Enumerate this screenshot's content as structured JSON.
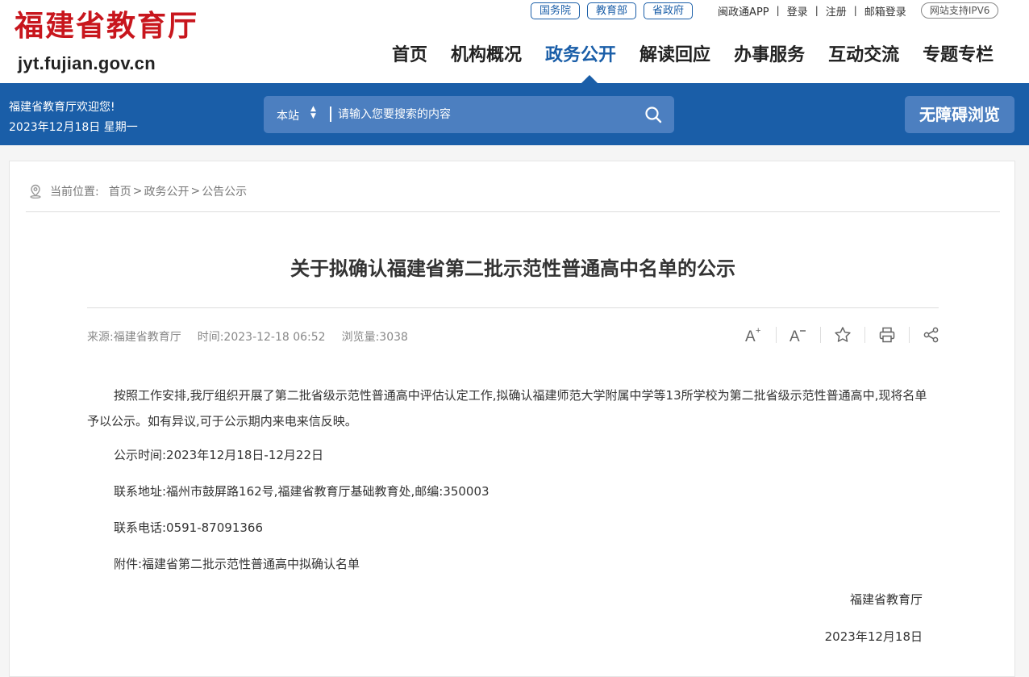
{
  "header": {
    "logo_cn": "福建省教育厅",
    "logo_url": "jyt.fujian.gov.cn",
    "pills": [
      "国务院",
      "教育部",
      "省政府"
    ],
    "links": [
      "闽政通APP",
      "登录",
      "注册",
      "邮箱登录"
    ],
    "ipv6": "网站支持IPV6",
    "nav": [
      "首页",
      "机构概况",
      "政务公开",
      "解读回应",
      "办事服务",
      "互动交流",
      "专题专栏"
    ],
    "nav_active_index": 2
  },
  "bluebar": {
    "welcome": "福建省教育厅欢迎您!",
    "date": "2023年12月18日 星期一",
    "scope": "本站",
    "search_placeholder": "请输入您要搜索的内容",
    "accessibility": "无障碍浏览"
  },
  "breadcrumb": {
    "label": "当前位置:",
    "items": [
      "首页",
      "政务公开",
      "公告公示"
    ]
  },
  "article": {
    "title": "关于拟确认福建省第二批示范性普通高中名单的公示",
    "source": "来源:福建省教育厅",
    "time": "时间:2023-12-18 06:52",
    "views": "浏览量:3038",
    "paragraphs": [
      "按照工作安排,我厅组织开展了第二批省级示范性普通高中评估认定工作,拟确认福建师范大学附属中学等13所学校为第二批省级示范性普通高中,现将名单予以公示。如有异议,可于公示期内来电来信反映。",
      "公示时间:2023年12月18日-12月22日",
      "联系地址:福州市鼓屏路162号,福建省教育厅基础教育处,邮编:350003",
      "联系电话:0591-87091366",
      "附件:福建省第二批示范性普通高中拟确认名单"
    ],
    "signature_org": "福建省教育厅",
    "signature_date": "2023年12月18日"
  }
}
